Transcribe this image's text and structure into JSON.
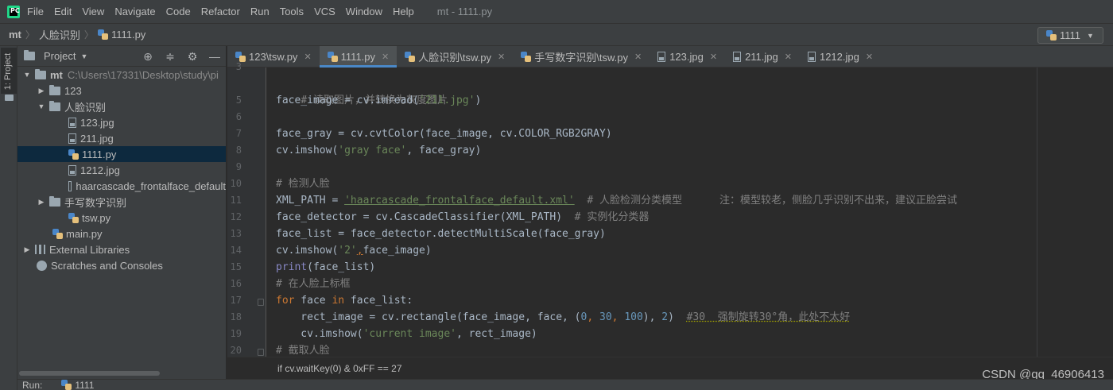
{
  "menu": {
    "items": [
      "File",
      "Edit",
      "View",
      "Navigate",
      "Code",
      "Refactor",
      "Run",
      "Tools",
      "VCS",
      "Window",
      "Help"
    ],
    "window_title": "mt - 1111.py"
  },
  "navbar": {
    "crumbs": [
      "mt",
      "人脸识别",
      "1111.py"
    ],
    "run_config": "1111"
  },
  "stripe": {
    "label": "1: Project"
  },
  "project": {
    "title": "Project",
    "tree": [
      {
        "label": "mt",
        "path": "C:\\Users\\17331\\Desktop\\study\\pi"
      },
      {
        "label": "123"
      },
      {
        "label": "人脸识别"
      },
      {
        "label": "123.jpg"
      },
      {
        "label": "211.jpg"
      },
      {
        "label": "1111.py"
      },
      {
        "label": "1212.jpg"
      },
      {
        "label": "haarcascade_frontalface_default"
      },
      {
        "label": "手写数字识别"
      },
      {
        "label": "tsw.py"
      },
      {
        "label": "main.py"
      },
      {
        "label": "External Libraries"
      },
      {
        "label": "Scratches and Consoles"
      }
    ]
  },
  "tabs": [
    {
      "label": "123\\tsw.py"
    },
    {
      "label": "1111.py"
    },
    {
      "label": "人脸识别\\tsw.py"
    },
    {
      "label": "手写数字识别\\tsw.py"
    },
    {
      "label": "123.jpg"
    },
    {
      "label": "211.jpg"
    },
    {
      "label": "1212.jpg"
    }
  ],
  "editor": {
    "line_numbers": [
      "3",
      "5",
      "6",
      "7",
      "8",
      "9",
      "10",
      "11",
      "12",
      "13",
      "14",
      "15",
      "16",
      "17",
      "18",
      "19",
      "20"
    ],
    "code": {
      "l4": "# 读取图片，并转换为灰度图片",
      "l5a": "face_image = cv.imread(",
      "l5s": "'211.jpg'",
      "l5b": ")",
      "l7a": "face_gray = cv.cvtColor(face_image, cv.COLOR_RGB2GRAY)",
      "l8a": "cv.imshow(",
      "l8s": "'gray face'",
      "l8b": ", face_gray)",
      "l10": "# 检测人脸",
      "l11a": "XML_PATH = ",
      "l11s": "'haarcascade_frontalface_default.xml'",
      "l11c": "  # 人脸检测分类模型      注：模型较老，侧脸几乎识别不出来，建议正脸尝试",
      "l12a": "face_detector = cv.CascadeClassifier(XML_PATH)",
      "l12c": "  # 实例化分类器",
      "l13a": "face_list = face_detector.detectMultiScale(face_gray)",
      "l14a": "cv.imshow(",
      "l14s": "'2'",
      "l14k": ",",
      "l14b": "face_image)",
      "l15b": "print",
      "l15a": "(face_list)",
      "l16": "# 在人脸上标框",
      "l17k": "for",
      "l17a": " face ",
      "l17k2": "in",
      "l17b": " face_list:",
      "l18a": "    rect_image = cv.rectangle(face_image, face, (",
      "l18n1": "0",
      "l18c1": ", ",
      "l18n2": "30",
      "l18c2": ", ",
      "l18n3": "100",
      "l18d": "), ",
      "l18n4": "2",
      "l18e": ")  ",
      "l18t": "#30  强制旋转30°角，此处不太好",
      "l19a": "    cv.imshow(",
      "l19s": "'current image'",
      "l19b": ", rect_image)",
      "l20": "# 截取人脸"
    }
  },
  "editor_crumb": "if cv.waitKey(0) & 0xFF == 27",
  "watermark": "CSDN @qq_46906413",
  "runbar": {
    "label": "Run:",
    "file": "1111"
  }
}
